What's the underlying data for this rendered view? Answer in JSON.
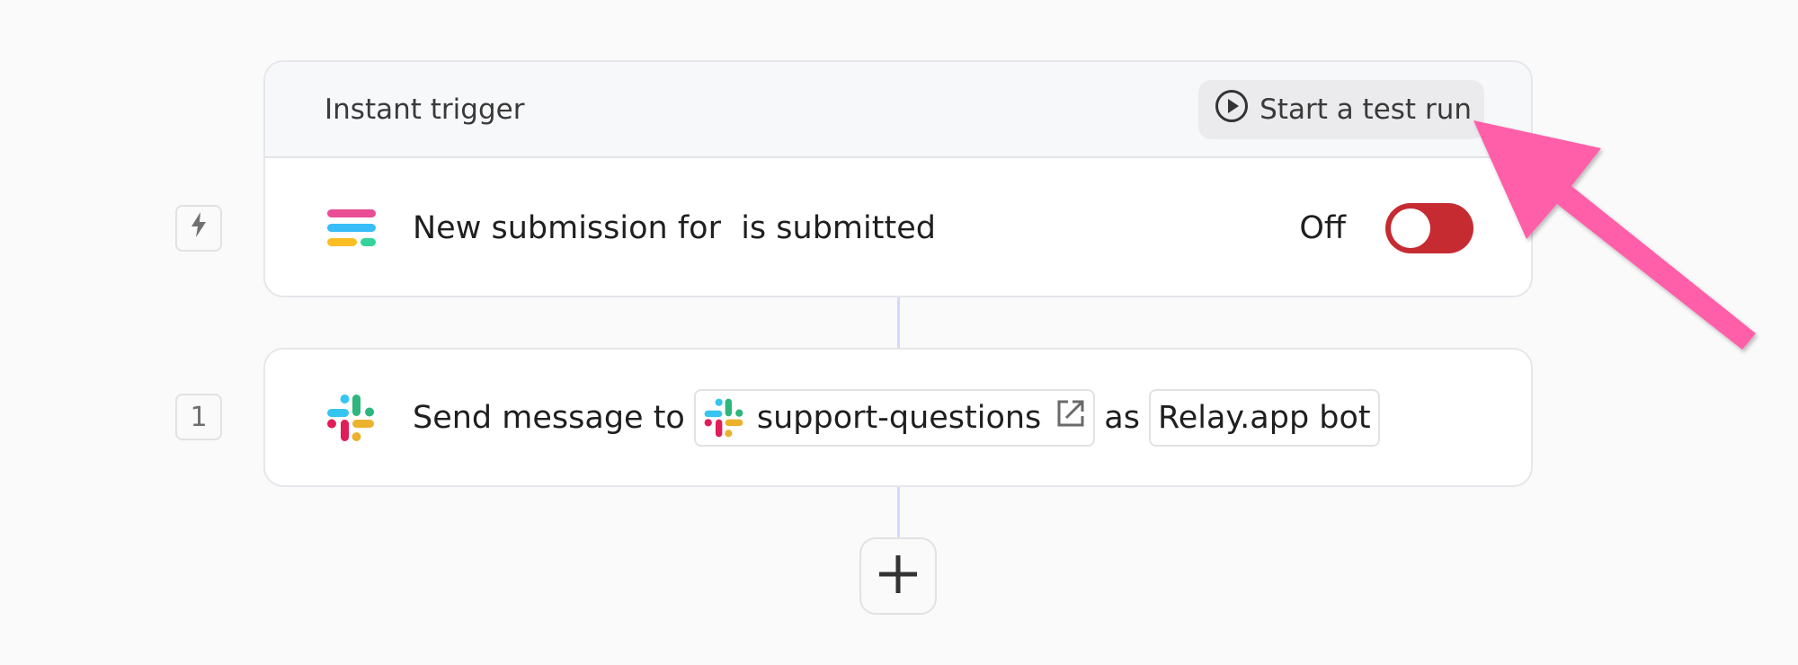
{
  "trigger": {
    "header_title": "Instant trigger",
    "test_run_label": "Start a test run",
    "step_badge_icon": "lightning-bolt-icon",
    "app_icon": "form-app-icon",
    "description": "New submission for  is submitted",
    "status_label": "Off",
    "enabled": false,
    "toggle_color": "#c62b31"
  },
  "action": {
    "step_number": "1",
    "app_icon": "slack-icon",
    "prefix": "Send message to",
    "channel": "support-questions",
    "channel_link_icon": "external-link-icon",
    "connector_word": "as",
    "sender": "Relay.app bot"
  },
  "add_step": {
    "icon": "plus-icon"
  },
  "annotation": {
    "type": "arrow",
    "color": "#ff5fa8",
    "points_to": "Start a test run"
  }
}
